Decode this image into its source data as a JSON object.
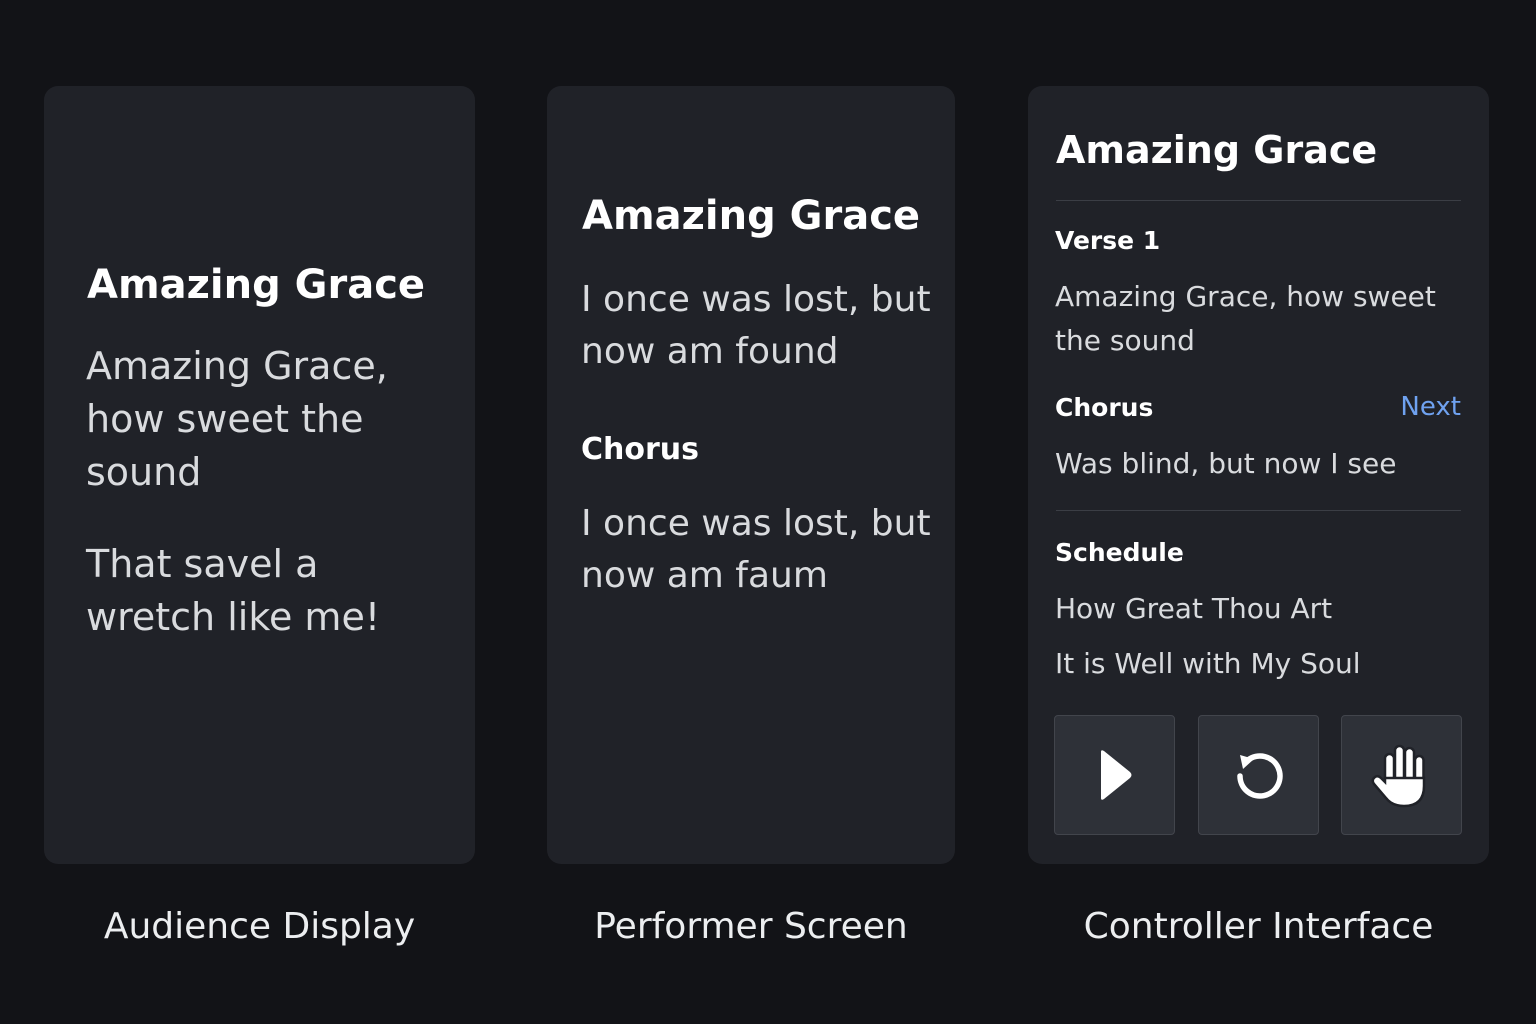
{
  "audience": {
    "title": "Amazing Grace",
    "line1": "Amazing Grace, how sweet the sound",
    "line2": "That savel a wretch like me!",
    "caption": "Audience Display"
  },
  "performer": {
    "title": "Amazing Grace",
    "line1": "I once was lost, but now am found",
    "section": "Chorus",
    "line2": "I once was lost, but now am faum",
    "caption": "Performer Screen"
  },
  "controller": {
    "title": "Amazing Grace",
    "verse_label": "Verse 1",
    "verse_text": "Amazing Grace, how sweet the sound",
    "chorus_label": "Chorus",
    "next_label": "Next",
    "chorus_text": "Was blind, but now I see",
    "schedule_label": "Schedule",
    "schedule": [
      "How Great Thou Art",
      "It is Well with My Soul"
    ],
    "buttons": [
      {
        "icon": "play-icon"
      },
      {
        "icon": "restart-icon"
      },
      {
        "icon": "hand-stop-icon"
      }
    ],
    "caption": "Controller Interface"
  },
  "colors": {
    "background": "#121317",
    "panel": "#202228",
    "accent": "#6fa2f0",
    "button": "#2e3138"
  }
}
